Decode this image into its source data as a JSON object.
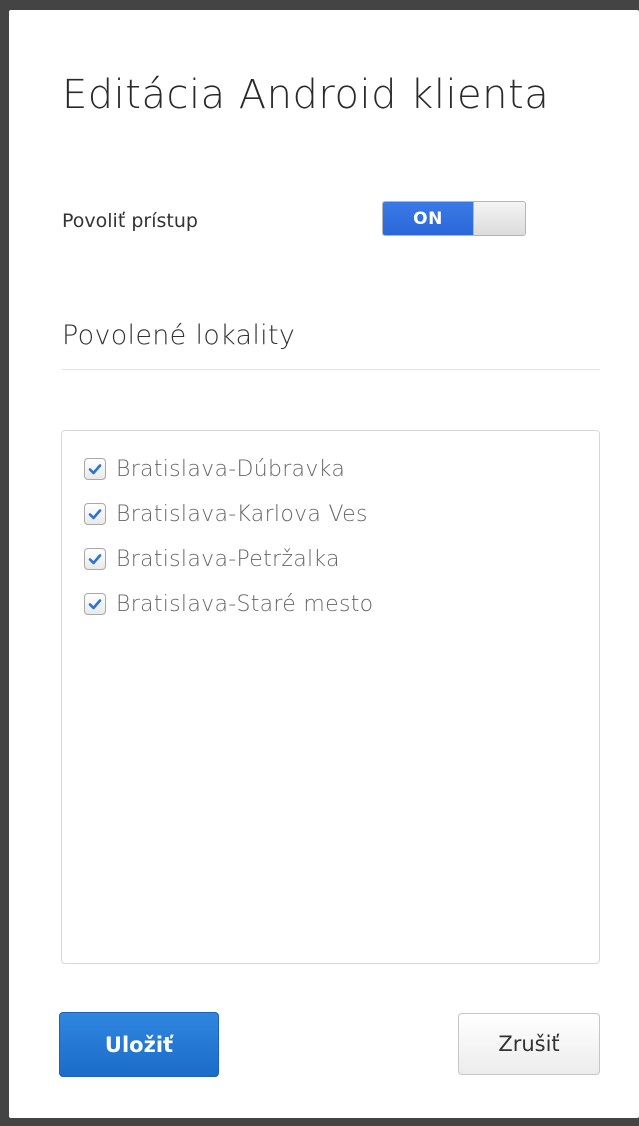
{
  "dialog": {
    "title": "Editácia Android klienta"
  },
  "access": {
    "label": "Povoliť prístup",
    "toggle_label": "ON",
    "enabled": true,
    "accent_color": "#2b67d8"
  },
  "locations": {
    "section_title": "Povolené lokality",
    "items": [
      {
        "label": "Bratislava-Dúbravka",
        "checked": true
      },
      {
        "label": "Bratislava-Karlova Ves",
        "checked": true
      },
      {
        "label": "Bratislava-Petržalka",
        "checked": true
      },
      {
        "label": "Bratislava-Staré mesto",
        "checked": true
      }
    ]
  },
  "actions": {
    "save_label": "Uložiť",
    "cancel_label": "Zrušiť",
    "save_color": "#1b6cc9"
  },
  "icons": {
    "checkbox": "check-icon"
  }
}
